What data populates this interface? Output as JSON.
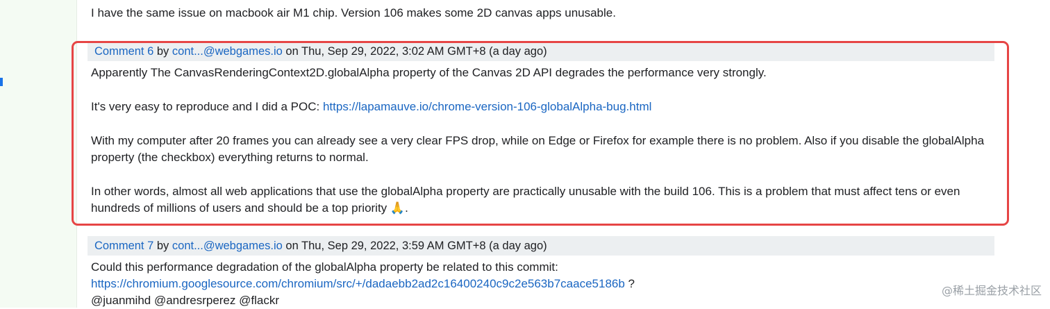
{
  "comment5": {
    "text": "I have the same issue on macbook air M1 chip. Version 106 makes some 2D canvas apps unusable."
  },
  "comment6": {
    "label": "Comment 6",
    "by": " by ",
    "author": "cont...@webgames.io",
    "date": " on Thu, Sep 29, 2022, 3:02 AM GMT+8 (a day ago)",
    "p1": "Apparently The CanvasRenderingContext2D.globalAlpha property of the Canvas 2D API degrades the performance very strongly.",
    "p2_prefix": "It's very easy to reproduce and I did a POC: ",
    "p2_link": "https://lapamauve.io/chrome-version-106-globalAlpha-bug.html",
    "p3": "With my computer after 20 frames you can already see a very clear FPS drop, while on Edge or Firefox for example there is no problem. Also if you disable the globalAlpha property (the checkbox) everything returns to normal.",
    "p4": "In other words, almost all web applications that use the globalAlpha property are practically unusable with the build 106. This is a problem that must affect tens or even hundreds of millions of users and should be a top priority 🙏."
  },
  "comment7": {
    "label": "Comment 7",
    "by": " by ",
    "author": "cont...@webgames.io",
    "date": " on Thu, Sep 29, 2022, 3:59 AM GMT+8 (a day ago)",
    "line1": "Could this performance degradation of the globalAlpha property be related to this commit:",
    "link": "https://chromium.googlesource.com/chromium/src/+/dadaebb2ad2c16400240c9c2e563b7caace5186b",
    "link_suffix": " ?",
    "mentions": "@juanmihd @andresrperez @flackr"
  },
  "watermark": "@稀土掘金技术社区",
  "colors": {
    "link": "#1a66c2",
    "highlight": "#e64545",
    "header_bg": "#eceff1"
  }
}
